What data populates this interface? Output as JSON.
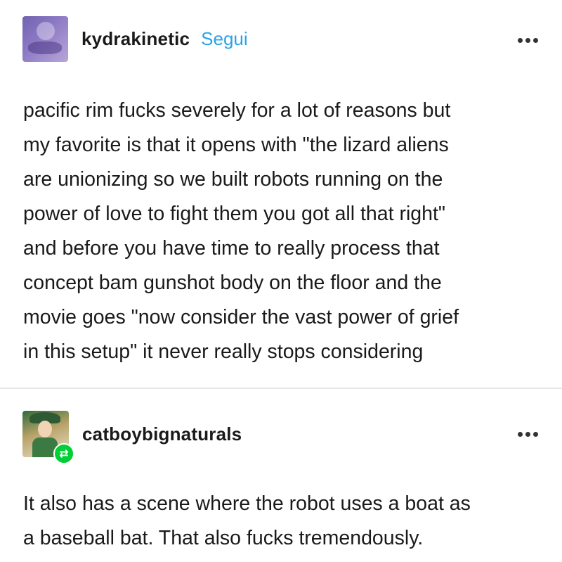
{
  "posts": [
    {
      "username": "kydrakinetic",
      "follow_label": "Segui",
      "avatar_icon": "purple-artwork-avatar",
      "more_icon": "more-options-icon",
      "lines": [
        "pacific rim fucks severely for a lot of reasons but",
        "my favorite is that it opens with \"the lizard aliens",
        "are unionizing so we built robots running on the",
        "power of love to fight them you got all that right\"",
        "and before you have time to really process that",
        "concept bam gunshot body on the floor and the",
        "movie goes \"now consider the vast power of grief",
        "in this setup\" it never really stops considering"
      ]
    },
    {
      "username": "catboybignaturals",
      "avatar_icon": "green-character-avatar",
      "reblog_icon": "reblog-icon",
      "reblog_badge_color": "#00cf35",
      "more_icon": "more-options-icon",
      "lines": [
        "It also has a scene where the robot uses a boat as",
        "a baseball bat. That also fucks tremendously."
      ]
    }
  ],
  "colors": {
    "follow_link": "#2aa3e8",
    "text": "#1a1a1a",
    "divider": "#e6e6e6"
  }
}
